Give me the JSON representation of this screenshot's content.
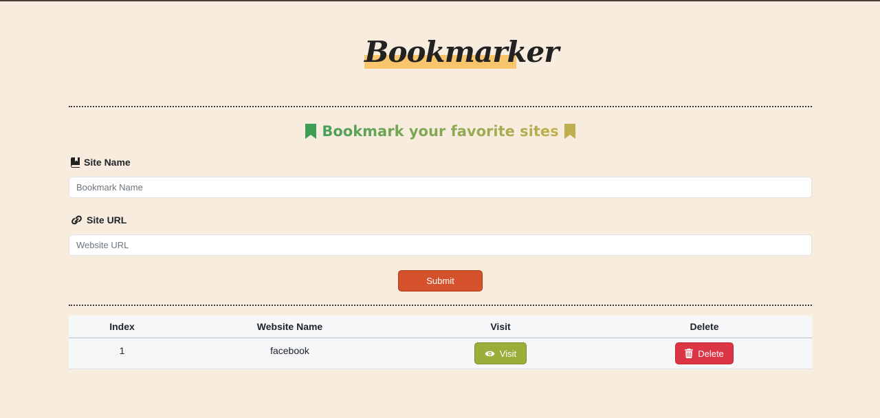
{
  "brand": {
    "title": "Bookmarker",
    "highlight_color": "#f9c56c"
  },
  "form": {
    "heading": "Bookmark your favorite sites",
    "heading_icon_left": "bookmark-icon",
    "heading_icon_right": "bookmark-icon",
    "site_name_label": "Site Name",
    "site_name_icon": "book-bookmark-icon",
    "site_name_placeholder": "Bookmark Name",
    "site_name_value": "",
    "site_url_label": "Site URL",
    "site_url_icon": "link-icon",
    "site_url_placeholder": "Website URL",
    "site_url_value": "",
    "submit_label": "Submit"
  },
  "table": {
    "headers": [
      "Index",
      "Website Name",
      "Visit",
      "Delete"
    ],
    "rows": [
      {
        "index": "1",
        "name": "facebook",
        "visit_label": "Visit",
        "delete_label": "Delete"
      }
    ]
  },
  "colors": {
    "background": "#f8ecdf",
    "submit": "#d4512c",
    "visit": "#9cad3b",
    "delete": "#dc3545",
    "heading_start": "#4aa05a",
    "heading_end": "#c2b04c"
  }
}
